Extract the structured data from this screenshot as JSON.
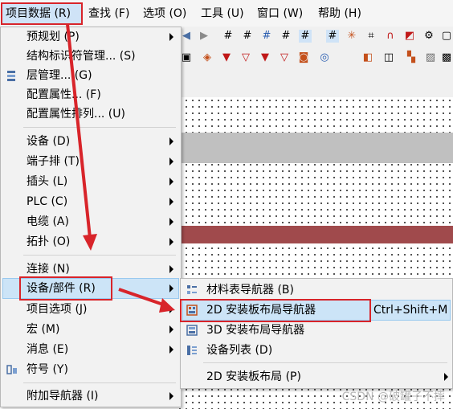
{
  "menubar": {
    "items": [
      {
        "label": "项目数据 (R)",
        "active": true
      },
      {
        "label": "查找 (F)"
      },
      {
        "label": "选项 (O)"
      },
      {
        "label": "工具 (U)"
      },
      {
        "label": "窗口 (W)"
      },
      {
        "label": "帮助 (H)"
      }
    ]
  },
  "project_menu": {
    "items": [
      {
        "label": "预规划 (P)",
        "submenu": true
      },
      {
        "label": "结构标识符管理... (S)"
      },
      {
        "label": "层管理... (G)",
        "icon": "layers-icon"
      },
      {
        "label": "配置属性... (F)"
      },
      {
        "label": "配置属性排列... (U)"
      },
      {
        "label": "设备 (D)",
        "submenu": true
      },
      {
        "label": "端子排 (T)",
        "submenu": true
      },
      {
        "label": "插头 (L)",
        "submenu": true
      },
      {
        "label": "PLC (C)",
        "submenu": true
      },
      {
        "label": "电缆 (A)",
        "submenu": true
      },
      {
        "label": "拓扑 (O)",
        "submenu": true
      },
      {
        "label": "连接 (N)",
        "submenu": true
      },
      {
        "label": "设备/部件 (R)",
        "submenu": true,
        "highlighted": true
      },
      {
        "label": "项目选项 (J)",
        "submenu": true
      },
      {
        "label": "宏 (M)",
        "submenu": true
      },
      {
        "label": "消息 (E)",
        "submenu": true
      },
      {
        "label": "符号 (Y)",
        "icon": "symbol-icon"
      },
      {
        "label": "附加导航器 (I)",
        "submenu": true
      }
    ]
  },
  "device_submenu": {
    "items": [
      {
        "label": "材料表导航器 (B)",
        "icon": "bom-navigator-icon"
      },
      {
        "label": "2D 安装板布局导航器",
        "shortcut": "Ctrl+Shift+M",
        "icon": "panel-layout-icon",
        "highlighted": true
      },
      {
        "label": "3D 安装布局导航器",
        "icon": "3d-layout-icon"
      },
      {
        "label": "设备列表 (D)",
        "icon": "device-list-icon"
      },
      {
        "label": "2D 安装板布局 (P)",
        "submenu": true
      }
    ]
  },
  "watermark": "CSDN @破罐子不摔",
  "colors": {
    "highlight": "#cce4f7",
    "annotation": "#d8242a",
    "band_gray": "#c0c0c0",
    "band_red": "#a04a4c"
  }
}
